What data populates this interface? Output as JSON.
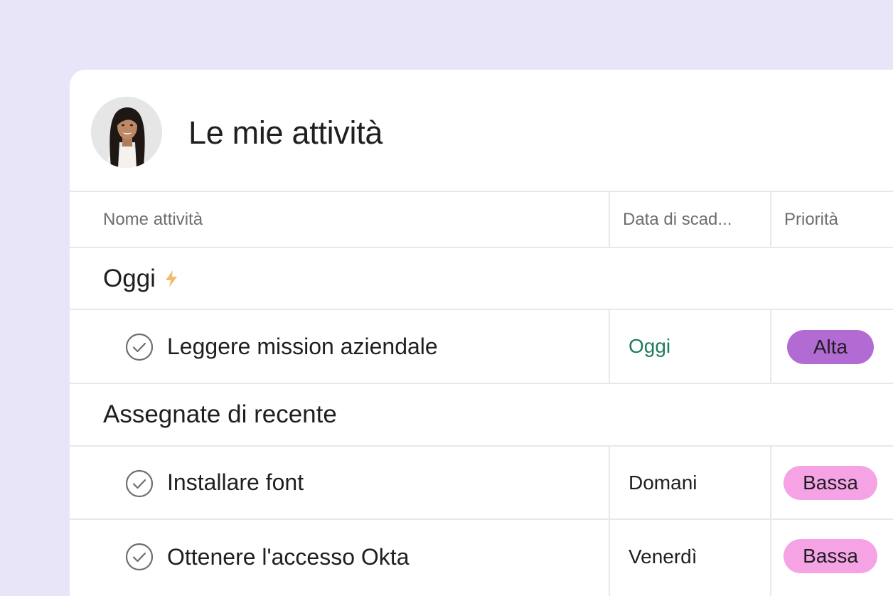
{
  "header": {
    "title": "Le mie attività",
    "avatar_icon": "user-avatar"
  },
  "columns": {
    "name": "Nome attività",
    "due": "Data di scad...",
    "priority": "Priorità"
  },
  "sections": [
    {
      "title": "Oggi",
      "icon": "lightning-bolt-icon",
      "tasks": [
        {
          "name": "Leggere mission aziendale",
          "due": "Oggi",
          "priority": "Alta"
        }
      ]
    },
    {
      "title": "Assegnate di recente",
      "tasks": [
        {
          "name": "Installare font",
          "due": "Domani",
          "priority": "Bassa"
        },
        {
          "name": "Ottenere l'accesso Okta",
          "due": "Venerdì",
          "priority": "Bassa"
        }
      ]
    }
  ],
  "colors": {
    "background": "#e7e5f7",
    "due_today": "#1f7c5a",
    "priority_high": "#b36bd4",
    "priority_low": "#f6a3e6",
    "bolt": "#f1bd6c"
  }
}
